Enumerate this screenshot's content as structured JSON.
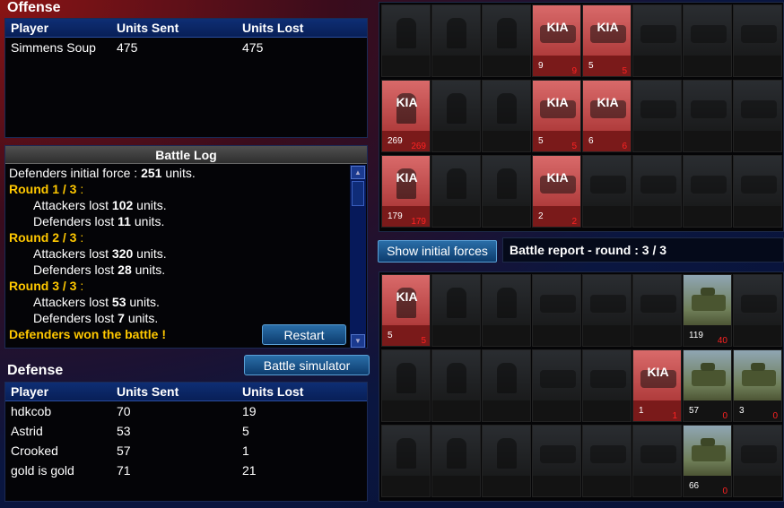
{
  "offense": {
    "title": "Offense",
    "headers": [
      "Player",
      "Units Sent",
      "Units Lost"
    ],
    "rows": [
      {
        "player": "Simmens Soup",
        "sent": "475",
        "lost": "475"
      }
    ]
  },
  "battle_log": {
    "title": "Battle Log",
    "initial": {
      "prefix": "Defenders initial force : ",
      "value": "251",
      "suffix": " units."
    },
    "rounds": [
      {
        "label": "Round 1 / 3",
        "atk": "102",
        "def": "11"
      },
      {
        "label": "Round 2 / 3",
        "atk": "320",
        "def": "28"
      },
      {
        "label": "Round 3 / 3",
        "atk": "53",
        "def": "7"
      }
    ],
    "atk_prefix": "Attackers lost ",
    "def_prefix": "Defenders lost ",
    "units_suffix": " units.",
    "round_suffix": " :",
    "result": "Defenders won the battle !",
    "restart": "Restart"
  },
  "battle_simulator": "Battle simulator",
  "defense": {
    "title": "Defense",
    "headers": [
      "Player",
      "Units Sent",
      "Units Lost"
    ],
    "rows": [
      {
        "player": "hdkcob",
        "sent": "70",
        "lost": "19"
      },
      {
        "player": "Astrid",
        "sent": "53",
        "lost": "5"
      },
      {
        "player": "Crooked",
        "sent": "57",
        "lost": "1"
      },
      {
        "player": "gold is gold",
        "sent": "71",
        "lost": "21"
      }
    ]
  },
  "show_initial": "Show initial forces",
  "report_title": "Battle report - round : 3 / 3",
  "kia_label": "KIA",
  "colors": {
    "accent_yellow": "#ffc800",
    "lost_red": "#ff2222",
    "header_blue": "#0e2e74"
  },
  "offense_grid": [
    [
      {
        "t": "inf"
      },
      {
        "t": "inf"
      },
      {
        "t": "inf"
      },
      {
        "t": "veh",
        "kia": true,
        "n": "9",
        "l": "9"
      },
      {
        "t": "veh",
        "kia": true,
        "n": "5",
        "l": "5"
      },
      {
        "t": "veh"
      },
      {
        "t": "veh"
      },
      {
        "t": "veh"
      }
    ],
    [
      {
        "t": "inf",
        "kia": true,
        "n": "269",
        "l": "269"
      },
      {
        "t": "inf"
      },
      {
        "t": "inf"
      },
      {
        "t": "veh",
        "kia": true,
        "n": "5",
        "l": "5"
      },
      {
        "t": "veh",
        "kia": true,
        "n": "6",
        "l": "6"
      },
      {
        "t": "veh"
      },
      {
        "t": "veh"
      },
      {
        "t": "veh"
      }
    ],
    [
      {
        "t": "inf",
        "kia": true,
        "n": "179",
        "l": "179"
      },
      {
        "t": "inf"
      },
      {
        "t": "inf"
      },
      {
        "t": "veh",
        "kia": true,
        "n": "2",
        "l": "2"
      },
      {
        "t": "veh"
      },
      {
        "t": "veh"
      },
      {
        "t": "veh"
      },
      {
        "t": "veh"
      }
    ]
  ],
  "defense_grid": [
    [
      {
        "t": "inf",
        "kia": true,
        "n": "5",
        "l": "5"
      },
      {
        "t": "inf"
      },
      {
        "t": "inf"
      },
      {
        "t": "veh"
      },
      {
        "t": "veh"
      },
      {
        "t": "veh"
      },
      {
        "t": "tank",
        "n": "119",
        "l": "40"
      },
      {
        "t": "veh"
      }
    ],
    [
      {
        "t": "inf"
      },
      {
        "t": "inf"
      },
      {
        "t": "inf"
      },
      {
        "t": "veh"
      },
      {
        "t": "veh"
      },
      {
        "t": "veh",
        "kia": true,
        "n": "1",
        "l": "1"
      },
      {
        "t": "tank",
        "n": "57",
        "l": "0"
      },
      {
        "t": "tank",
        "n": "3",
        "l": "0"
      }
    ],
    [
      {
        "t": "inf"
      },
      {
        "t": "inf"
      },
      {
        "t": "inf"
      },
      {
        "t": "veh"
      },
      {
        "t": "veh"
      },
      {
        "t": "veh"
      },
      {
        "t": "tank",
        "n": "66",
        "l": "0"
      },
      {
        "t": "veh"
      }
    ]
  ]
}
